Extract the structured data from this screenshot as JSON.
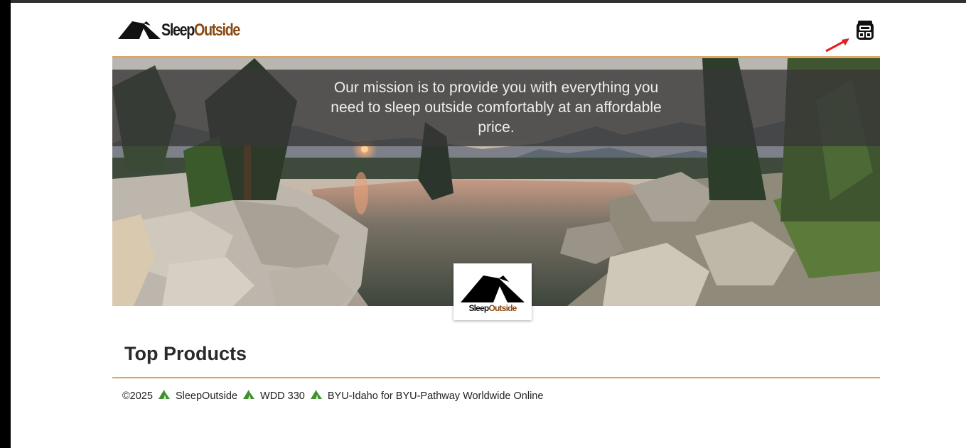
{
  "header": {
    "logo": {
      "part1": "Sleep",
      "part2": "Outside"
    },
    "cart_icon": "backpack-icon",
    "annotation_icon": "red-arrow-icon"
  },
  "hero": {
    "mission": "Our mission is to provide you with everything you need to sleep outside comfortably at an affordable price.",
    "badge_logo": {
      "part1": "Sleep",
      "part2": "Outside"
    }
  },
  "main": {
    "section_title": "Top Products"
  },
  "footer": {
    "copyright": "©2025",
    "items": [
      "SleepOutside",
      "WDD 330",
      "BYU-Idaho for BYU-Pathway Worldwide Online"
    ],
    "separator_icon": "tent-icon"
  },
  "colors": {
    "accent": "#d8a86a",
    "brand_brown": "#8a4a14",
    "overlay": "#373737",
    "annotation": "#e02020"
  }
}
